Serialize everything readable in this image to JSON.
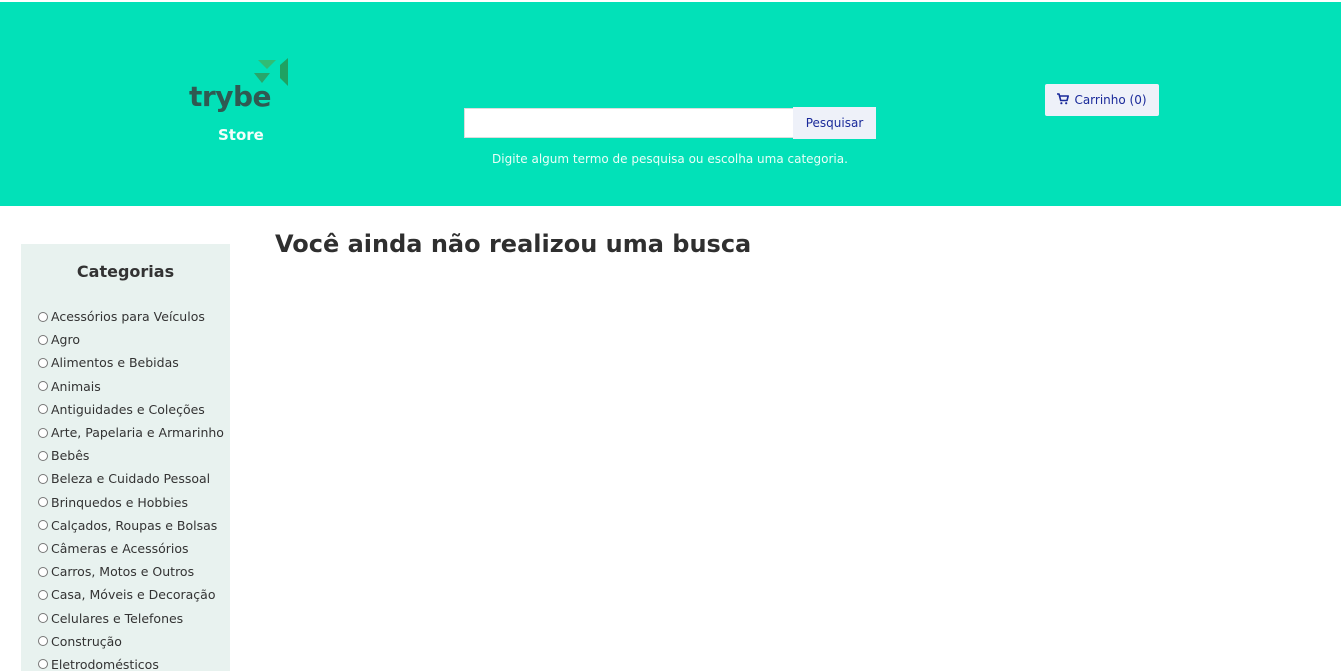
{
  "header": {
    "background": "#02e1b8",
    "logo": {
      "brand": "trybe",
      "subtitle": "Store",
      "icon": "trybe-logo-icon"
    },
    "search": {
      "input_value": "",
      "placeholder": "",
      "button_label": "Pesquisar",
      "hint": "Digite algum termo de pesquisa ou escolha uma categoria."
    },
    "cart": {
      "icon": "cart-icon",
      "label": "Carrinho (0)"
    }
  },
  "sidebar": {
    "title": "Categorias",
    "background": "#e8f2ef",
    "categories": [
      {
        "label": "Acessórios para Veículos",
        "selected": false
      },
      {
        "label": "Agro",
        "selected": false
      },
      {
        "label": "Alimentos e Bebidas",
        "selected": false
      },
      {
        "label": "Animais",
        "selected": false
      },
      {
        "label": "Antiguidades e Coleções",
        "selected": false
      },
      {
        "label": "Arte, Papelaria e Armarinho",
        "selected": false
      },
      {
        "label": "Bebês",
        "selected": false
      },
      {
        "label": "Beleza e Cuidado Pessoal",
        "selected": false
      },
      {
        "label": "Brinquedos e Hobbies",
        "selected": false
      },
      {
        "label": "Calçados, Roupas e Bolsas",
        "selected": false
      },
      {
        "label": "Câmeras e Acessórios",
        "selected": false
      },
      {
        "label": "Carros, Motos e Outros",
        "selected": false
      },
      {
        "label": "Casa, Móveis e Decoração",
        "selected": false
      },
      {
        "label": "Celulares e Telefones",
        "selected": false
      },
      {
        "label": "Construção",
        "selected": false
      },
      {
        "label": "Eletrodomésticos",
        "selected": false
      }
    ]
  },
  "main": {
    "empty_message": "Você ainda não realizou uma busca"
  }
}
